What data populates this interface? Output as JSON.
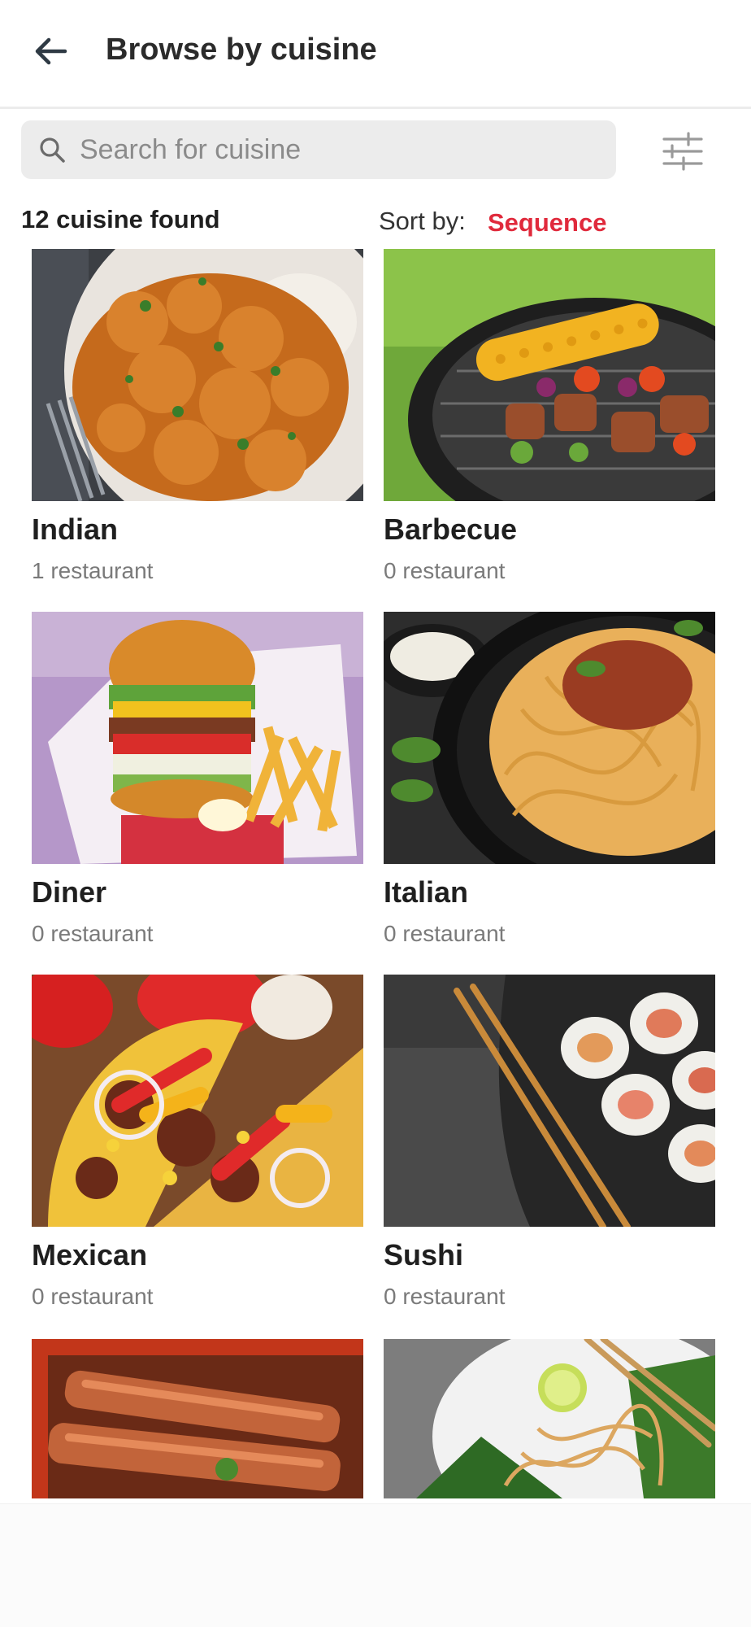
{
  "header": {
    "title": "Browse by cuisine",
    "back_icon": "arrow-left-icon"
  },
  "search": {
    "placeholder": "Search for cuisine",
    "value": "",
    "icon": "search-icon"
  },
  "filter": {
    "icon": "sliders-icon"
  },
  "results": {
    "count_text": "12 cuisine found",
    "sort_label": "Sort by:",
    "sort_value": "Sequence"
  },
  "cuisines": [
    {
      "name": "Indian",
      "count": "1 restaurant"
    },
    {
      "name": "Barbecue",
      "count": "0 restaurant"
    },
    {
      "name": "Diner",
      "count": "0 restaurant"
    },
    {
      "name": "Italian",
      "count": "0 restaurant"
    },
    {
      "name": "Mexican",
      "count": "0 restaurant"
    },
    {
      "name": "Sushi",
      "count": "0 restaurant"
    }
  ],
  "colors": {
    "accent": "#e02a3c",
    "text": "#1f1f1f",
    "muted": "#7a7a7a",
    "search_bg": "#ececec"
  }
}
